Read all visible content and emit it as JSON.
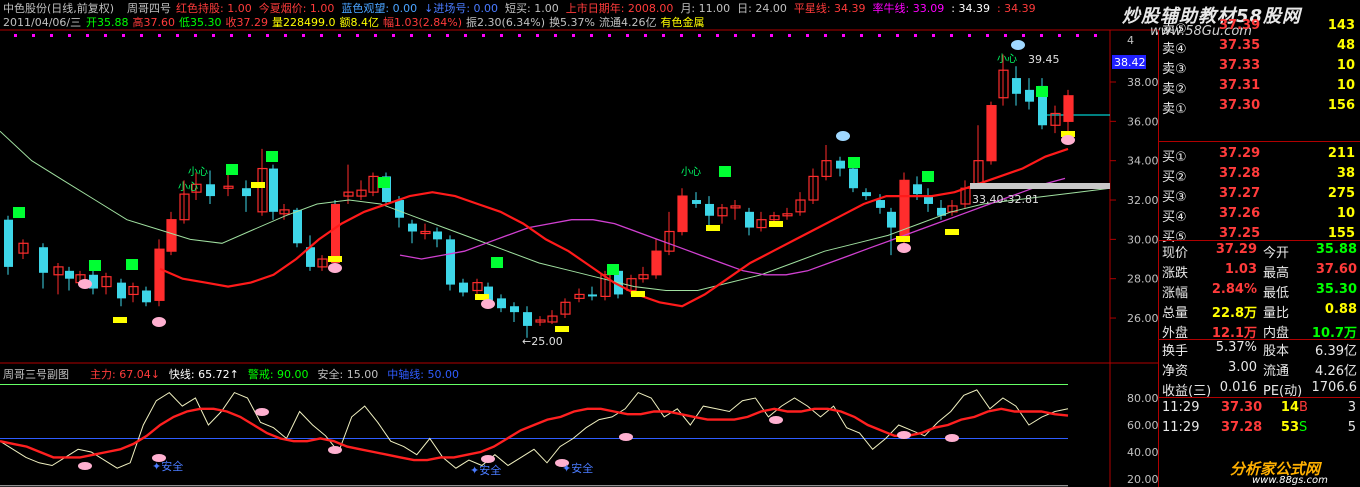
{
  "header": {
    "stock": "中色股份(日线,前复权)",
    "indicator_name": "周哥四号",
    "items": [
      {
        "text": "红色持股: 1.00",
        "color": "#ff3b3b"
      },
      {
        "text": "今夏烟价: 1.00",
        "color": "#ff3b3b"
      },
      {
        "text": "蓝色观望: 0.00",
        "color": "#4aa3ff"
      },
      {
        "text": "↓进场号: 0.00",
        "color": "#4a7bff"
      },
      {
        "text": "短买: 1.00",
        "color": "#c0c0c0"
      },
      {
        "text": "上市日期年: 2008.00",
        "color": "#ff3b3b"
      },
      {
        "text": "月: 11.00",
        "color": "#c0c0c0"
      },
      {
        "text": "日: 24.00",
        "color": "#c0c0c0"
      },
      {
        "text": "平星线: 34.39",
        "color": "#ff3b3b"
      },
      {
        "text": "率牛线: 33.09",
        "color": "#ff00ff"
      },
      {
        "text": ": 34.39",
        "color": "#ffffff"
      },
      {
        "text": ": 34.39",
        "color": "#ff3b3b"
      }
    ]
  },
  "info": {
    "date": "2011/04/06/三",
    "items": [
      {
        "text": "开35.88",
        "color": "#00ff00"
      },
      {
        "text": "高37.60",
        "color": "#ff3b3b"
      },
      {
        "text": "低35.30",
        "color": "#00ff00"
      },
      {
        "text": "收37.29",
        "color": "#ff3b3b"
      },
      {
        "text": "量228499.0",
        "color": "#ffff00"
      },
      {
        "text": "额8.4亿",
        "color": "#ffff00"
      },
      {
        "text": "幅1.03(2.84%)",
        "color": "#ff3b3b"
      },
      {
        "text": "振2.30(6.34%)",
        "color": "#c0c0c0"
      },
      {
        "text": "换5.37%",
        "color": "#c0c0c0"
      },
      {
        "text": "流通4.26亿",
        "color": "#c0c0c0"
      },
      {
        "text": "有色金属",
        "color": "#ffff00"
      }
    ]
  },
  "main_axis": {
    "labels": [
      "38.00",
      "36.00",
      "34.00",
      "32.00",
      "30.00",
      "28.00",
      "26.00"
    ],
    "current_price_tag": "38.42",
    "small_label": "4"
  },
  "annotations": {
    "high_label": "39.45",
    "low_label": "←25.00",
    "range_label": "33.40-32.81",
    "careful_labels": [
      "小心",
      "小心",
      "小心",
      "小心"
    ]
  },
  "sub_panel": {
    "title": "周哥三号副图",
    "items": [
      {
        "text": "主力: 67.04↓",
        "color": "#ff3b3b"
      },
      {
        "text": "快线: 65.72↑",
        "color": "#ffffff"
      },
      {
        "text": "警戒: 90.00",
        "color": "#00ff00"
      },
      {
        "text": "安全: 15.00",
        "color": "#c0c0c0"
      },
      {
        "text": "中轴线: 50.00",
        "color": "#2f5cff"
      }
    ],
    "axis_labels": [
      "80.00",
      "60.00",
      "40.00",
      "20.00"
    ],
    "tags": [
      "安全",
      "安全",
      "安全"
    ]
  },
  "order_book": {
    "sells": [
      {
        "label": "卖⑤",
        "price": "37.39",
        "vol": "143"
      },
      {
        "label": "卖④",
        "price": "37.35",
        "vol": "48"
      },
      {
        "label": "卖③",
        "price": "37.33",
        "vol": "10"
      },
      {
        "label": "卖②",
        "price": "37.31",
        "vol": "10"
      },
      {
        "label": "卖①",
        "price": "37.30",
        "vol": "156"
      }
    ],
    "buys": [
      {
        "label": "买①",
        "price": "37.29",
        "vol": "211"
      },
      {
        "label": "买②",
        "price": "37.28",
        "vol": "38"
      },
      {
        "label": "买③",
        "price": "37.27",
        "vol": "275"
      },
      {
        "label": "买④",
        "price": "37.26",
        "vol": "10"
      },
      {
        "label": "买⑤",
        "price": "37.25",
        "vol": "155"
      }
    ]
  },
  "quote": {
    "rows": [
      {
        "l1": "现价",
        "v1": "37.29",
        "c1": "#ff3b3b",
        "l2": "今开",
        "v2": "35.88",
        "c2": "#00ff00"
      },
      {
        "l1": "涨跌",
        "v1": "1.03",
        "c1": "#ff3b3b",
        "l2": "最高",
        "v2": "37.60",
        "c2": "#ff3b3b"
      },
      {
        "l1": "涨幅",
        "v1": "2.84%",
        "c1": "#ff3b3b",
        "l2": "最低",
        "v2": "35.30",
        "c2": "#00ff00"
      },
      {
        "l1": "总量",
        "v1": "22.8万",
        "c1": "#ffff00",
        "l2": "量比",
        "v2": "0.88",
        "c2": "#ffff00"
      },
      {
        "l1": "外盘",
        "v1": "12.1万",
        "c1": "#ff3b3b",
        "l2": "内盘",
        "v2": "10.7万",
        "c2": "#00ff00"
      }
    ],
    "rows2": [
      {
        "l1": "换手",
        "v1": "5.37%",
        "l2": "股本",
        "v2": "6.39亿"
      },
      {
        "l1": "净资",
        "v1": "3.00",
        "l2": "流通",
        "v2": "4.26亿"
      },
      {
        "l1": "收益(三)",
        "v1": "0.016",
        "l2": "PE(动)",
        "v2": "1706.6"
      }
    ],
    "ticks": [
      {
        "time": "11:29",
        "price": "37.30",
        "vol": "14",
        "side": "B",
        "n": "3"
      },
      {
        "time": "11:29",
        "price": "37.28",
        "vol": "53",
        "side": "S",
        "n": "5"
      }
    ]
  },
  "watermark": {
    "title": "炒股辅助教材58股网",
    "url": "www.58Gu.com"
  },
  "footer_ad": {
    "title": "分析家公式网",
    "url": "www.88gs.com"
  },
  "chart_data": {
    "type": "line",
    "title": "",
    "xlabel": "",
    "ylabel": "",
    "ylim": [
      25,
      40
    ],
    "series": [
      {
        "values": [
          31,
          29.5,
          28.5,
          28,
          27.8,
          27.6,
          27.4,
          27.2,
          28,
          31,
          32.2,
          32.6,
          32.8,
          32.6,
          32.4,
          32,
          31.8,
          31.4,
          30.6,
          29.2,
          28.4,
          27.4,
          26.8,
          26.4,
          27.2,
          28.6,
          30.4,
          31.2,
          31.6,
          31.8,
          32.4,
          33.2,
          33.2,
          34,
          33.6,
          32.8,
          32.8,
          32.6,
          32.4,
          33,
          35.2,
          36.2,
          37.6,
          36.8,
          37.2
        ]
      },
      {
        "values": [
          28.5,
          28,
          27.8,
          27.6,
          27.8,
          28.2,
          29,
          30,
          30.8,
          31.4,
          31.8,
          32.2,
          32.4,
          32.2,
          31.8,
          31.4,
          30.8,
          30,
          29.4,
          28.6,
          27.8,
          27.2,
          26.8,
          26.6,
          27.2,
          28,
          28.8,
          29.4,
          30,
          30.6,
          31.2,
          31.8,
          32.2,
          32.2,
          32.2,
          32.4,
          32.8,
          33.2,
          33.6,
          34.2,
          34.6
        ]
      },
      {
        "values": [
          29.2,
          29,
          29.2,
          29.4,
          29.8,
          30.2,
          30.6,
          30.8,
          31,
          31,
          30.8,
          30.4,
          30,
          29.6,
          29.2,
          28.8,
          28.4,
          28.2,
          28.2,
          28.4,
          28.8,
          29.2,
          29.6,
          30,
          30.4,
          30.8,
          31.2,
          31.6,
          32,
          32.4,
          32.8,
          33.1
        ]
      },
      {
        "values": [
          35.5,
          34,
          33,
          32,
          31,
          30.5,
          30,
          29.8,
          30.5,
          31.2,
          31.8,
          32,
          31.8,
          31.2,
          30.6,
          30,
          29.4,
          28.8,
          28.4,
          28,
          27.6,
          27.4,
          27.4,
          27.8,
          28.2,
          28.8,
          29.4,
          29.8,
          30.2,
          30.8,
          31.4,
          31.8,
          32,
          32.2,
          32.4,
          32.6
        ]
      }
    ]
  }
}
